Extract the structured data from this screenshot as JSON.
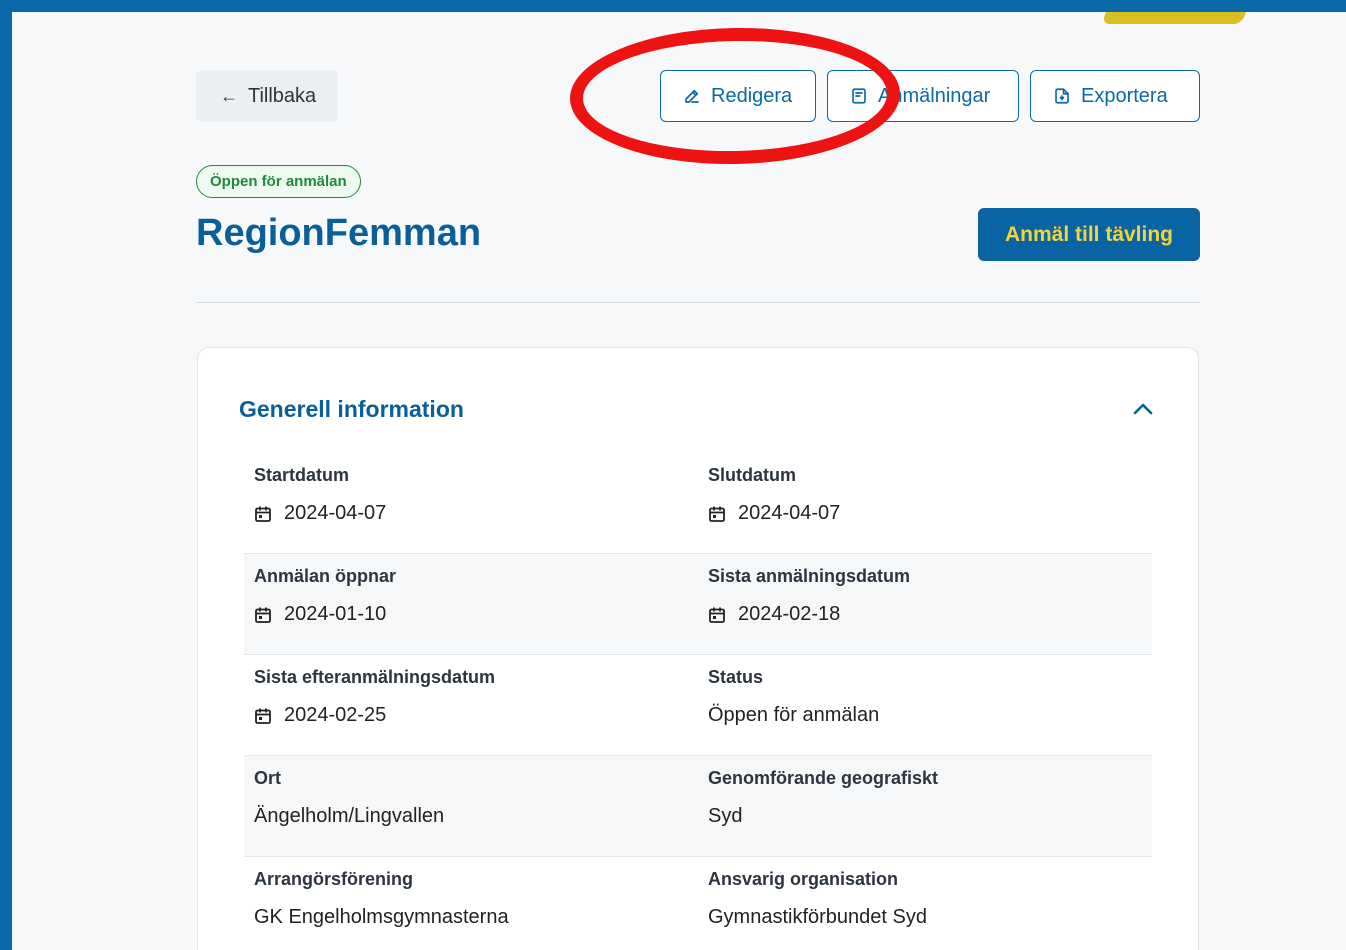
{
  "toolbar": {
    "back_label": "Tillbaka",
    "edit_label": "Redigera",
    "registrations_label": "Anmälningar",
    "export_label": "Exportera"
  },
  "header": {
    "status_badge": "Öppen för anmälan",
    "title": "RegionFemman",
    "signup_label": "Anmäl till tävling"
  },
  "general": {
    "title": "Generell information",
    "rows": [
      {
        "left": {
          "label": "Startdatum",
          "value": "2024-04-07",
          "icon": "calendar-icon"
        },
        "right": {
          "label": "Slutdatum",
          "value": "2024-04-07",
          "icon": "calendar-icon"
        }
      },
      {
        "left": {
          "label": "Anmälan öppnar",
          "value": "2024-01-10",
          "icon": "calendar-icon"
        },
        "right": {
          "label": "Sista anmälningsdatum",
          "value": "2024-02-18",
          "icon": "calendar-icon"
        }
      },
      {
        "left": {
          "label": "Sista efteranmälningsdatum",
          "value": "2024-02-25",
          "icon": "calendar-icon"
        },
        "right": {
          "label": "Status",
          "value": "Öppen för anmälan"
        }
      },
      {
        "left": {
          "label": "Ort",
          "value": "Ängelholm/Lingvallen"
        },
        "right": {
          "label": "Genomförande geografiskt",
          "value": "Syd"
        }
      },
      {
        "left": {
          "label": "Arrangörsförening",
          "value": "GK Engelholmsgymnasterna"
        },
        "right": {
          "label": "Ansvarig organisation",
          "value": "Gymnastikförbundet Syd"
        }
      }
    ]
  },
  "colors": {
    "frame": "#0a6aa8",
    "primary": "#0a64a2",
    "accent_yellow": "#f5d33a",
    "annotation_red": "#ee1313",
    "status_green": "#1e8a3b"
  }
}
